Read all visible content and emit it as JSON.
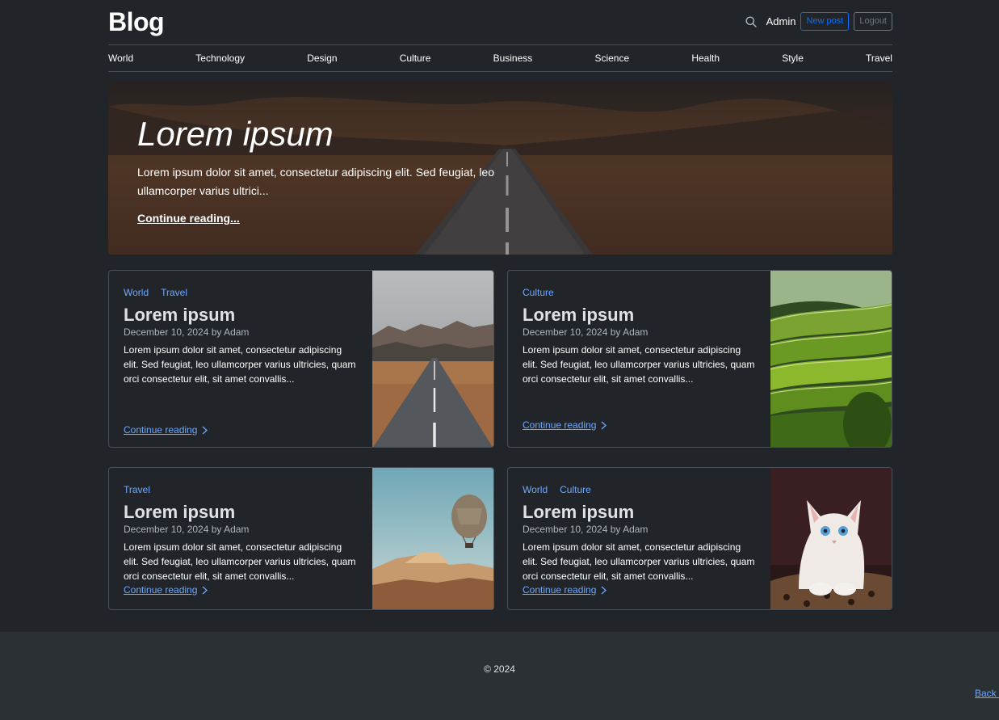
{
  "header": {
    "brand": "Blog",
    "user": "Admin",
    "new_post_label": "New post",
    "logout_label": "Logout"
  },
  "nav": [
    "World",
    "Technology",
    "Design",
    "Culture",
    "Business",
    "Science",
    "Health",
    "Style",
    "Travel"
  ],
  "hero": {
    "title": "Lorem ipsum",
    "lead": "Lorem ipsum dolor sit amet, consectetur adipiscing elit. Sed feugiat, leo ullamcorper varius ultrici...",
    "link": "Continue reading..."
  },
  "posts": [
    {
      "tags": [
        "World",
        "Travel"
      ],
      "title": "Lorem ipsum",
      "meta": "December 10, 2024 by Adam",
      "excerpt": "Lorem ipsum dolor sit amet, consectetur adipiscing elit. Sed feugiat, leo ullamcorper varius ultricies, quam orci consectetur elit, sit amet convallis...",
      "link": "Continue reading",
      "image": "mountain-road"
    },
    {
      "tags": [
        "Culture"
      ],
      "title": "Lorem ipsum",
      "meta": "December 10, 2024 by Adam",
      "excerpt": "Lorem ipsum dolor sit amet, consectetur adipiscing elit. Sed feugiat, leo ullamcorper varius ultricies, quam orci consectetur elit, sit amet convallis...",
      "link": "Continue reading",
      "image": "rice-terraces"
    },
    {
      "tags": [
        "Travel"
      ],
      "title": "Lorem ipsum",
      "meta": "December 10, 2024 by Adam",
      "excerpt": "Lorem ipsum dolor sit amet, consectetur adipiscing elit. Sed feugiat, leo ullamcorper varius ultricies, quam orci consectetur elit, sit amet convallis...",
      "link": "Continue reading",
      "image": "hot-air-balloon"
    },
    {
      "tags": [
        "World",
        "Culture"
      ],
      "title": "Lorem ipsum",
      "meta": "December 10, 2024 by Adam",
      "excerpt": "Lorem ipsum dolor sit amet, consectetur adipiscing elit. Sed feugiat, leo ullamcorper varius ultricies, quam orci consectetur elit, sit amet convallis...",
      "link": "Continue reading",
      "image": "white-kitten"
    }
  ],
  "footer": {
    "copyright": "© 2024",
    "back_to_top": "Back to top"
  },
  "colors": {
    "background": "#212529",
    "link": "#6ea8fe",
    "primary": "#0d6efd",
    "footer": "#2b3035"
  }
}
